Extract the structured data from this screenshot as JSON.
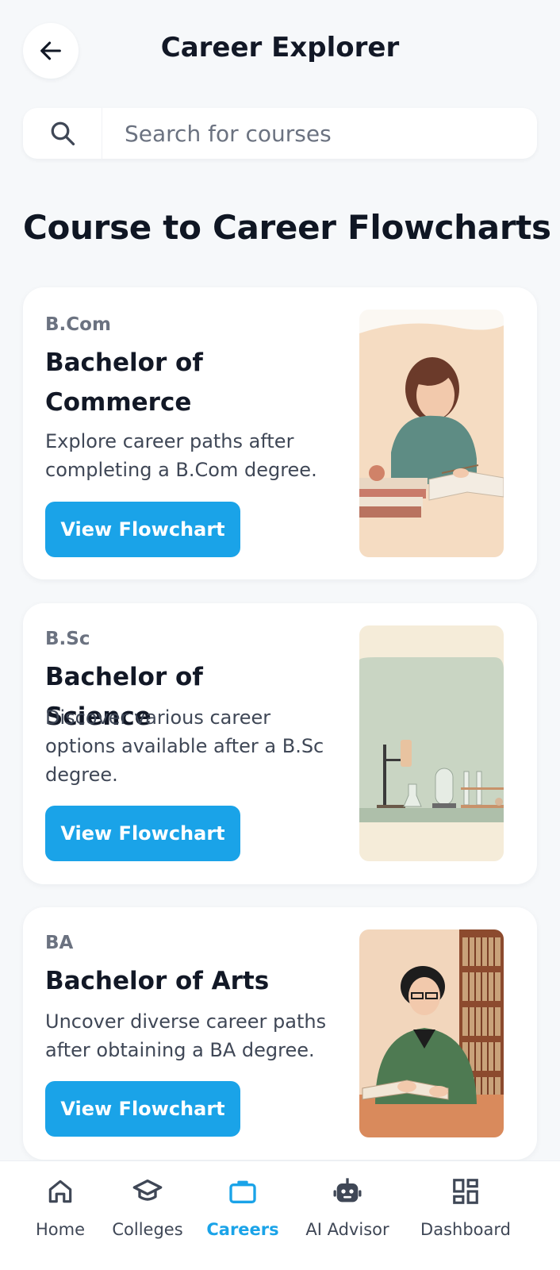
{
  "header": {
    "title": "Career Explorer"
  },
  "search": {
    "placeholder": "Search for courses",
    "value": ""
  },
  "section": {
    "title": "Course to Career Flowcharts"
  },
  "cards": [
    {
      "code": "B.Com",
      "name": "Bachelor of Commerce",
      "description": "Explore career paths after completing a B.Com degree.",
      "button_label": "View Flowchart"
    },
    {
      "code": "B.Sc",
      "name": "Bachelor of Science",
      "description": "Discover various career options available after a B.Sc degree.",
      "button_label": "View Flowchart"
    },
    {
      "code": "BA",
      "name": "Bachelor of Arts",
      "description": "Uncover diverse career paths after obtaining a BA degree.",
      "button_label": "View Flowchart"
    }
  ],
  "nav": {
    "items": [
      {
        "label": "Home",
        "icon": "home-icon",
        "active": false
      },
      {
        "label": "Colleges",
        "icon": "graduation-cap-icon",
        "active": false
      },
      {
        "label": "Careers",
        "icon": "briefcase-icon",
        "active": true
      },
      {
        "label": "AI Advisor",
        "icon": "robot-icon",
        "active": false
      },
      {
        "label": "Dashboard",
        "icon": "dashboard-icon",
        "active": false
      }
    ]
  },
  "colors": {
    "accent": "#1aa3e8",
    "background": "#f6f8fa",
    "card": "#ffffff",
    "text_primary": "#121826",
    "text_secondary": "#6b7280"
  }
}
